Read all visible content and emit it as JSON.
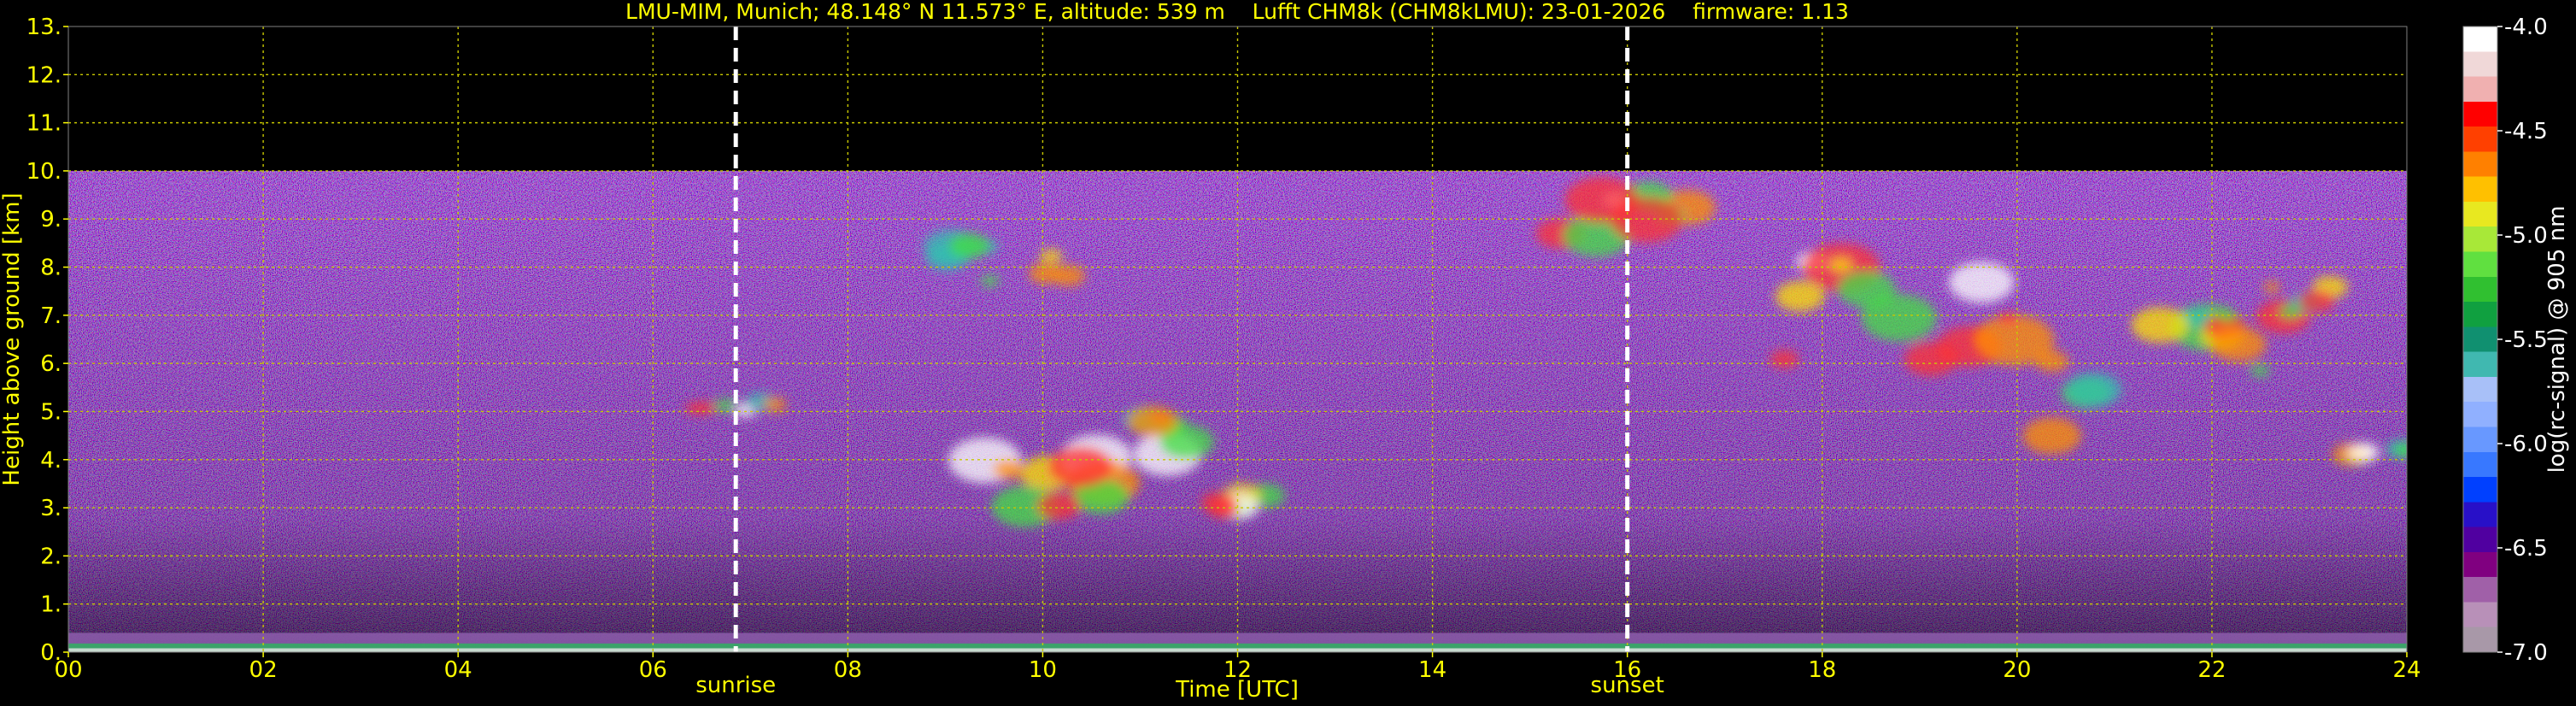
{
  "chart_data": {
    "type": "heatmap",
    "title": "LMU-MIM, Munich; 48.148° N 11.573° E, altitude: 539 m    Lufft CHM8k (CHM8kLMU): 23-01-2026    firmware: 1.13",
    "xlabel": "Time [UTC]",
    "ylabel": "Height above ground [km]",
    "xlim": [
      0,
      24
    ],
    "ylim": [
      0,
      13
    ],
    "x_ticks": [
      0,
      2,
      4,
      6,
      8,
      10,
      12,
      14,
      16,
      18,
      20,
      22,
      24
    ],
    "x_tick_labels": [
      "00",
      "02",
      "04",
      "06",
      "08",
      "10",
      "12",
      "14",
      "16",
      "18",
      "20",
      "22",
      "24"
    ],
    "y_ticks": [
      0,
      1,
      2,
      3,
      4,
      5,
      6,
      7,
      8,
      9,
      10,
      11,
      12,
      13
    ],
    "y_tick_labels": [
      "0.",
      "1.",
      "2.",
      "3.",
      "4.",
      "5.",
      "6.",
      "7.",
      "8.",
      "9.",
      "10.",
      "11.",
      "12.",
      "13."
    ],
    "grid": true,
    "data_top_km": 10,
    "colorbar": {
      "label": "log(rc-signal) @ 905 nm",
      "range": [
        -7.0,
        -4.0
      ],
      "ticks": [
        -4.0,
        -4.5,
        -5.0,
        -5.5,
        -6.0,
        -6.5,
        -7.0
      ],
      "tick_labels": [
        "-4.0",
        "-4.5",
        "-5.0",
        "-5.5",
        "-6.0",
        "-6.5",
        "-7.0"
      ],
      "colors": [
        "#a898a8",
        "#b890b8",
        "#a060a8",
        "#800080",
        "#5000a0",
        "#2810c8",
        "#0040ff",
        "#3878ff",
        "#6898ff",
        "#90b0ff",
        "#a8c0f8",
        "#40b8b0",
        "#109070",
        "#10a040",
        "#30c030",
        "#60e040",
        "#a8e838",
        "#e8e820",
        "#ffc000",
        "#ff8000",
        "#ff4000",
        "#ff0000",
        "#f0b0b0",
        "#f0d8d8",
        "#ffffff"
      ]
    },
    "events": [
      {
        "label": "sunrise",
        "time": 6.85
      },
      {
        "label": "sunset",
        "time": 16.0
      }
    ],
    "features": [
      {
        "kind": "surface-layer",
        "t_start": 0,
        "t_end": 24,
        "h_start": 0.0,
        "h_end": 0.4
      },
      {
        "kind": "cloud",
        "t_start": 6.3,
        "t_end": 7.3,
        "h_start": 5.0,
        "h_end": 5.3
      },
      {
        "kind": "cloud",
        "t_start": 9.3,
        "t_end": 11.0,
        "h_start": 2.8,
        "h_end": 4.8
      },
      {
        "kind": "cloud",
        "t_start": 10.8,
        "t_end": 11.5,
        "h_start": 3.8,
        "h_end": 4.9
      },
      {
        "kind": "cloud",
        "t_start": 11.6,
        "t_end": 12.3,
        "h_start": 2.8,
        "h_end": 3.3
      },
      {
        "kind": "cloud",
        "t_start": 9.0,
        "t_end": 10.5,
        "h_start": 7.7,
        "h_end": 8.5
      },
      {
        "kind": "cloud",
        "t_start": 15.0,
        "t_end": 16.8,
        "h_start": 8.5,
        "h_end": 9.7
      },
      {
        "kind": "cloud",
        "t_start": 17.5,
        "t_end": 19.7,
        "h_start": 6.0,
        "h_end": 8.2
      },
      {
        "kind": "cloud",
        "t_start": 19.9,
        "t_end": 20.9,
        "h_start": 4.3,
        "h_end": 7.2
      },
      {
        "kind": "cloud",
        "t_start": 21.0,
        "t_end": 22.5,
        "h_start": 5.8,
        "h_end": 7.0
      },
      {
        "kind": "cloud",
        "t_start": 22.6,
        "t_end": 23.6,
        "h_start": 6.8,
        "h_end": 7.6
      },
      {
        "kind": "cloud",
        "t_start": 23.4,
        "t_end": 24.0,
        "h_start": 4.0,
        "h_end": 4.3
      }
    ]
  }
}
